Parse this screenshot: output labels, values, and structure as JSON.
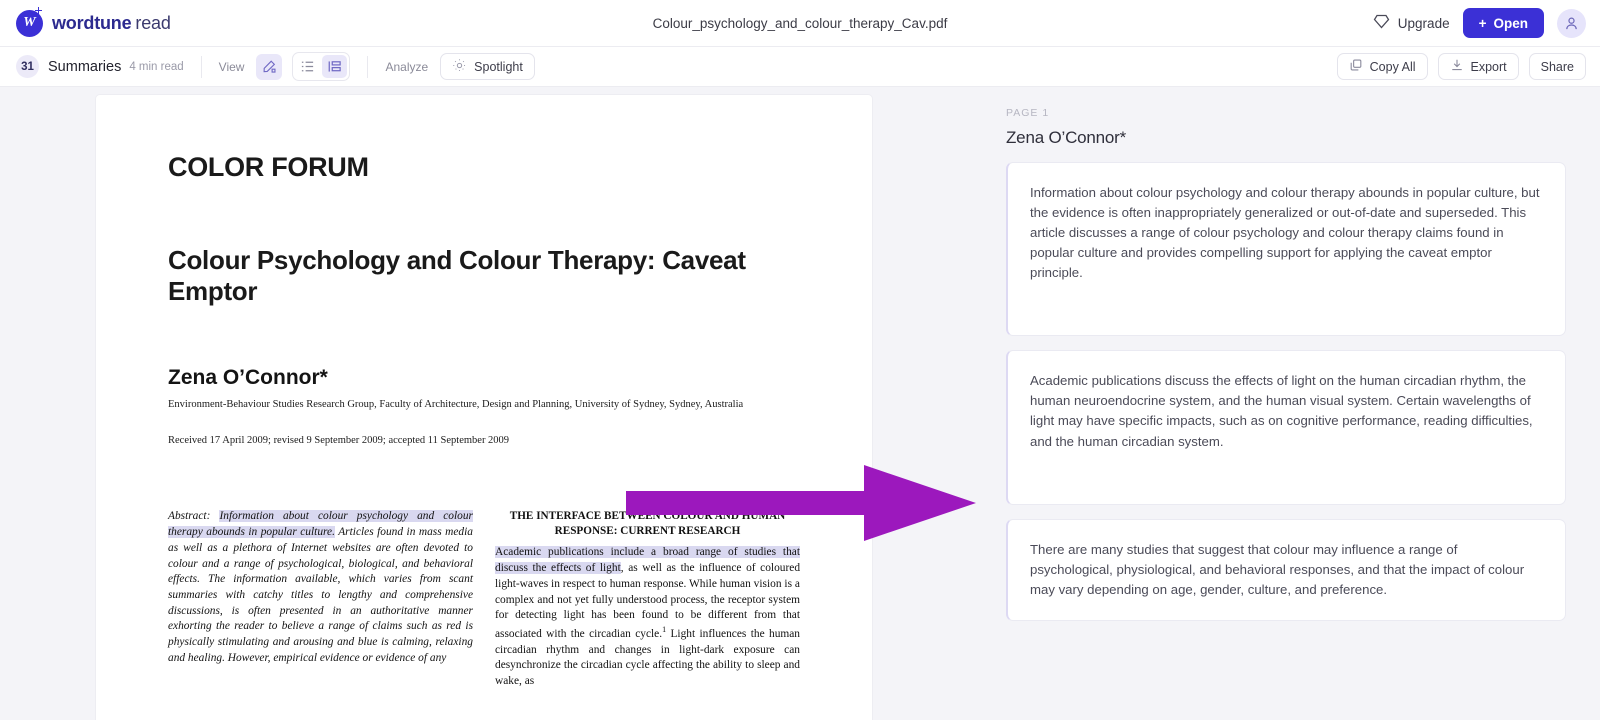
{
  "header": {
    "brand_bold": "wordtune",
    "brand_light": "read",
    "doc_title": "Colour_psychology_and_colour_therapy_Cav.pdf",
    "upgrade_label": "Upgrade",
    "open_label": "Open",
    "open_plus": "+"
  },
  "toolbar": {
    "summaries_count": "31",
    "summaries_label": "Summaries",
    "read_time": "4 min read",
    "view_label": "View",
    "analyze_label": "Analyze",
    "spotlight_label": "Spotlight",
    "copy_all_label": "Copy All",
    "export_label": "Export",
    "share_label": "Share"
  },
  "document": {
    "forum": "COLOR FORUM",
    "title": "Colour Psychology and Colour Therapy: Caveat Emptor",
    "author": "Zena O’Connor*",
    "affiliation": "Environment-Behaviour Studies Research Group, Faculty of Architecture, Design and Planning, University of Sydney, Sydney, Australia",
    "received": "Received 17 April 2009; revised 9 September 2009; accepted 11 September 2009",
    "abstract_label": "Abstract:",
    "abstract_highlighted": "Information about colour psychology and colour therapy abounds in popular culture.",
    "abstract_rest": "Articles found in mass media as well as a plethora of Internet websites are often devoted to colour and a range of psychological, biological, and behavioral effects. The information available, which varies from scant summaries with catchy titles to lengthy and comprehensive discussions, is often presented in an authoritative manner exhorting the reader to believe a range of claims such as red is physically stimulating and arousing and blue is calming, relaxing and healing. However, empirical evidence or evidence of any",
    "section_heading": "THE INTERFACE BETWEEN COLOUR AND HUMAN RESPONSE: CURRENT RESEARCH",
    "section_highlighted": "Academic publications include a broad range of studies that discuss the effects of light",
    "section_rest": ", as well as the influence of coloured light-waves in respect to human response. While human vision is a complex and not yet fully understood process, the receptor system for detecting light has been found to be different from that associated with the circadian cycle.",
    "section_footnote": "1",
    "section_rest2": " Light influences the human circadian rhythm and changes in light-dark exposure can desynchronize the circadian cycle affecting the ability to sleep and wake, as"
  },
  "summaries": {
    "page_tag": "PAGE 1",
    "author": "Zena O’Connor*",
    "cards": [
      "Information about colour psychology and colour therapy abounds in popular culture, but the evidence is often inappropriately generalized or out-of-date and superseded. This article discusses a range of colour psychology and colour therapy claims found in popular culture and provides compelling support for applying the caveat emptor principle.",
      "Academic publications discuss the effects of light on the human circadian rhythm, the human neuroendocrine system, and the human visual system. Certain wavelengths of light may have specific impacts, such as on cognitive performance, reading difficulties, and the human circadian system.",
      "There are many studies that suggest that colour may influence a range of psychological, physiological, and behavioral responses, and that the impact of colour may vary depending on age, gender, culture, and preference."
    ]
  },
  "colors": {
    "brand_blue": "#3b30d6",
    "arrow_purple": "#9c18bd",
    "highlight": "#d9d8f0",
    "background": "#f4f4f8"
  },
  "annotation": {
    "arrow_name": "purple-pointer-arrow"
  }
}
